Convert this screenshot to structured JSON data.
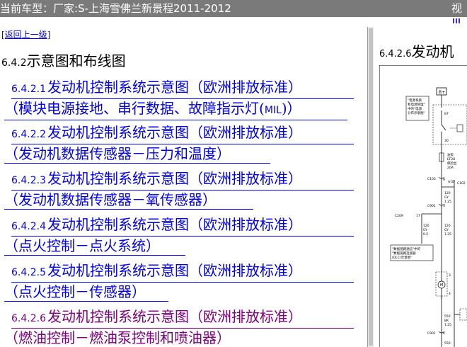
{
  "title_bar": {
    "text": "当前车型：厂家:S-上海雪佛兰新景程2011-2012",
    "view_label": "视"
  },
  "back_link": "[返回上一级]",
  "section": {
    "num": "6.4.2",
    "title": "示意图和布线图"
  },
  "links": [
    {
      "num": "6.4.2.1",
      "title": "发动机控制系统示意图（欧洲排放标准）",
      "sub_pre": "（模块电源接地、串行数据、故障指示灯(",
      "sub_mil": "MIL",
      "sub_post": ")）",
      "visited": false
    },
    {
      "num": "6.4.2.2",
      "title": "发动机控制系统示意图（欧洲排放标准）",
      "sub": "（发动机数据传感器－压力和温度）",
      "visited": false
    },
    {
      "num": "6.4.2.3",
      "title": "发动机控制系统示意图（欧洲排放标准）",
      "sub": "（发动机数据传感器－氧传感器）",
      "visited": false
    },
    {
      "num": "6.4.2.4",
      "title": "发动机控制系统示意图（欧洲排放标准）",
      "sub": "（点火控制－点火系统）",
      "visited": false
    },
    {
      "num": "6.4.2.5",
      "title": "发动机控制系统示意图（欧洲排放标准）",
      "sub": "（点火控制－传感器）",
      "visited": false
    },
    {
      "num": "6.4.2.6",
      "title": "发动机控制系统示意图（欧洲排放标准）",
      "sub": "（燃油控制－燃油泵控制和喷油器）",
      "visited": true
    }
  ],
  "right_panel": {
    "num": "6.4.2.6",
    "title": "发动机"
  },
  "diagram": {
    "labels": {
      "bplus": "B+",
      "note1a": "\"电源系统",
      "note1b": "和电源管理\"",
      "note1c": "中的\"电源",
      "note1d": "分布示意图\"",
      "n87": "87",
      "n30": "30",
      "fuse1": "油泵",
      "fuse2": "EF28",
      "fuse3": "保险丝",
      "fuse4": "20A",
      "c103": "C103",
      "c103pin": "9",
      "a10": "A10",
      "c102": "C102",
      "w120a": "120",
      "w120b": "GY",
      "w120c": "1.25",
      "c901a": "C901",
      "c901pin": "3",
      "c209": "C209",
      "c209pin": "17",
      "w120d": "120",
      "w120e": "GY",
      "w120f": "0.5",
      "w120g": "120",
      "w120h": "GY",
      "w120i": "1.25",
      "note2a": "\"数据链路通信\"中的",
      "note2b": "\"数据链路连接器",
      "note2c": "(DLC)示意图\"",
      "pin3": "3",
      "pin4": "4",
      "w550a": "550",
      "w550b": "BK",
      "w550c": "1.25",
      "c901b": "C901",
      "c901pin2": "4",
      "w550d": "550"
    }
  }
}
